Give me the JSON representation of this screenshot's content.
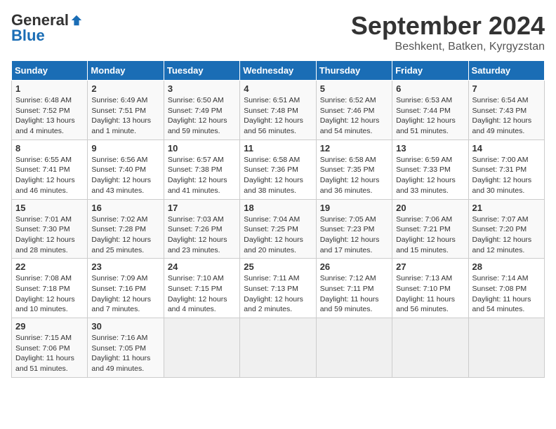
{
  "logo": {
    "general": "General",
    "blue": "Blue"
  },
  "title": "September 2024",
  "location": "Beshkent, Batken, Kyrgyzstan",
  "days_of_week": [
    "Sunday",
    "Monday",
    "Tuesday",
    "Wednesday",
    "Thursday",
    "Friday",
    "Saturday"
  ],
  "weeks": [
    [
      {
        "day": "1",
        "info": "Sunrise: 6:48 AM\nSunset: 7:52 PM\nDaylight: 13 hours\nand 4 minutes."
      },
      {
        "day": "2",
        "info": "Sunrise: 6:49 AM\nSunset: 7:51 PM\nDaylight: 13 hours\nand 1 minute."
      },
      {
        "day": "3",
        "info": "Sunrise: 6:50 AM\nSunset: 7:49 PM\nDaylight: 12 hours\nand 59 minutes."
      },
      {
        "day": "4",
        "info": "Sunrise: 6:51 AM\nSunset: 7:48 PM\nDaylight: 12 hours\nand 56 minutes."
      },
      {
        "day": "5",
        "info": "Sunrise: 6:52 AM\nSunset: 7:46 PM\nDaylight: 12 hours\nand 54 minutes."
      },
      {
        "day": "6",
        "info": "Sunrise: 6:53 AM\nSunset: 7:44 PM\nDaylight: 12 hours\nand 51 minutes."
      },
      {
        "day": "7",
        "info": "Sunrise: 6:54 AM\nSunset: 7:43 PM\nDaylight: 12 hours\nand 49 minutes."
      }
    ],
    [
      {
        "day": "8",
        "info": "Sunrise: 6:55 AM\nSunset: 7:41 PM\nDaylight: 12 hours\nand 46 minutes."
      },
      {
        "day": "9",
        "info": "Sunrise: 6:56 AM\nSunset: 7:40 PM\nDaylight: 12 hours\nand 43 minutes."
      },
      {
        "day": "10",
        "info": "Sunrise: 6:57 AM\nSunset: 7:38 PM\nDaylight: 12 hours\nand 41 minutes."
      },
      {
        "day": "11",
        "info": "Sunrise: 6:58 AM\nSunset: 7:36 PM\nDaylight: 12 hours\nand 38 minutes."
      },
      {
        "day": "12",
        "info": "Sunrise: 6:58 AM\nSunset: 7:35 PM\nDaylight: 12 hours\nand 36 minutes."
      },
      {
        "day": "13",
        "info": "Sunrise: 6:59 AM\nSunset: 7:33 PM\nDaylight: 12 hours\nand 33 minutes."
      },
      {
        "day": "14",
        "info": "Sunrise: 7:00 AM\nSunset: 7:31 PM\nDaylight: 12 hours\nand 30 minutes."
      }
    ],
    [
      {
        "day": "15",
        "info": "Sunrise: 7:01 AM\nSunset: 7:30 PM\nDaylight: 12 hours\nand 28 minutes."
      },
      {
        "day": "16",
        "info": "Sunrise: 7:02 AM\nSunset: 7:28 PM\nDaylight: 12 hours\nand 25 minutes."
      },
      {
        "day": "17",
        "info": "Sunrise: 7:03 AM\nSunset: 7:26 PM\nDaylight: 12 hours\nand 23 minutes."
      },
      {
        "day": "18",
        "info": "Sunrise: 7:04 AM\nSunset: 7:25 PM\nDaylight: 12 hours\nand 20 minutes."
      },
      {
        "day": "19",
        "info": "Sunrise: 7:05 AM\nSunset: 7:23 PM\nDaylight: 12 hours\nand 17 minutes."
      },
      {
        "day": "20",
        "info": "Sunrise: 7:06 AM\nSunset: 7:21 PM\nDaylight: 12 hours\nand 15 minutes."
      },
      {
        "day": "21",
        "info": "Sunrise: 7:07 AM\nSunset: 7:20 PM\nDaylight: 12 hours\nand 12 minutes."
      }
    ],
    [
      {
        "day": "22",
        "info": "Sunrise: 7:08 AM\nSunset: 7:18 PM\nDaylight: 12 hours\nand 10 minutes."
      },
      {
        "day": "23",
        "info": "Sunrise: 7:09 AM\nSunset: 7:16 PM\nDaylight: 12 hours\nand 7 minutes."
      },
      {
        "day": "24",
        "info": "Sunrise: 7:10 AM\nSunset: 7:15 PM\nDaylight: 12 hours\nand 4 minutes."
      },
      {
        "day": "25",
        "info": "Sunrise: 7:11 AM\nSunset: 7:13 PM\nDaylight: 12 hours\nand 2 minutes."
      },
      {
        "day": "26",
        "info": "Sunrise: 7:12 AM\nSunset: 7:11 PM\nDaylight: 11 hours\nand 59 minutes."
      },
      {
        "day": "27",
        "info": "Sunrise: 7:13 AM\nSunset: 7:10 PM\nDaylight: 11 hours\nand 56 minutes."
      },
      {
        "day": "28",
        "info": "Sunrise: 7:14 AM\nSunset: 7:08 PM\nDaylight: 11 hours\nand 54 minutes."
      }
    ],
    [
      {
        "day": "29",
        "info": "Sunrise: 7:15 AM\nSunset: 7:06 PM\nDaylight: 11 hours\nand 51 minutes."
      },
      {
        "day": "30",
        "info": "Sunrise: 7:16 AM\nSunset: 7:05 PM\nDaylight: 11 hours\nand 49 minutes."
      },
      {
        "day": "",
        "info": ""
      },
      {
        "day": "",
        "info": ""
      },
      {
        "day": "",
        "info": ""
      },
      {
        "day": "",
        "info": ""
      },
      {
        "day": "",
        "info": ""
      }
    ]
  ]
}
